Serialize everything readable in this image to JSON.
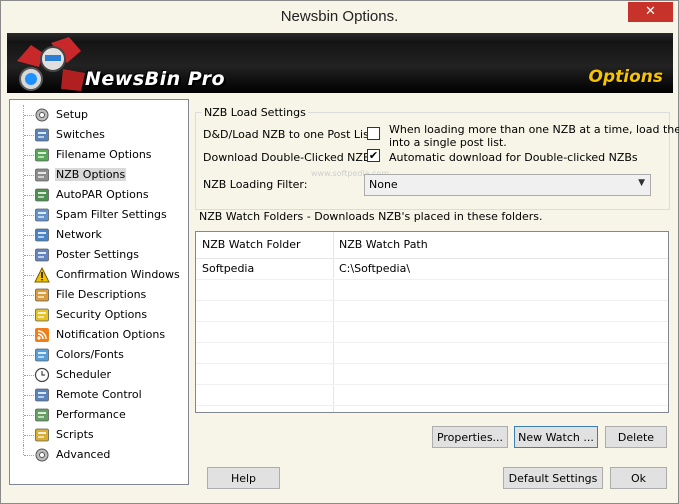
{
  "window": {
    "title": "Newsbin Options.",
    "close_label": "✕"
  },
  "banner": {
    "brand": "NewsBin Pro",
    "section": "Options"
  },
  "sidebar": {
    "items": [
      {
        "label": "Setup",
        "icon": "gear-icon"
      },
      {
        "label": "Switches",
        "icon": "switches-icon"
      },
      {
        "label": "Filename Options",
        "icon": "filename-icon"
      },
      {
        "label": "NZB Options",
        "icon": "nzb-icon",
        "selected": true
      },
      {
        "label": "AutoPAR Options",
        "icon": "autopar-icon"
      },
      {
        "label": "Spam Filter Settings",
        "icon": "spam-filter-icon"
      },
      {
        "label": "Network",
        "icon": "network-icon"
      },
      {
        "label": "Poster Settings",
        "icon": "poster-icon"
      },
      {
        "label": "Confirmation Windows",
        "icon": "warning-icon"
      },
      {
        "label": "File Descriptions",
        "icon": "file-descriptions-icon"
      },
      {
        "label": "Security Options",
        "icon": "security-icon"
      },
      {
        "label": "Notification Options",
        "icon": "rss-icon"
      },
      {
        "label": "Colors/Fonts",
        "icon": "colors-icon"
      },
      {
        "label": "Scheduler",
        "icon": "clock-icon"
      },
      {
        "label": "Remote Control",
        "icon": "remote-icon"
      },
      {
        "label": "Performance",
        "icon": "performance-icon"
      },
      {
        "label": "Scripts",
        "icon": "scripts-icon"
      },
      {
        "label": "Advanced",
        "icon": "advanced-gear-icon"
      }
    ]
  },
  "nzb_load": {
    "group_title": "NZB Load Settings",
    "row1_label": "D&D/Load NZB to one Post List:",
    "row1_checkbox_line1": "When loading more than one NZB at a time, load them",
    "row1_checkbox_line2": "into a single post list.",
    "row1_checked": false,
    "row2_label": "Download Double-Clicked NZB:",
    "row2_checkbox": "Automatic download for Double-clicked NZBs",
    "row2_checked": true,
    "filter_label": "NZB Loading Filter:",
    "filter_value": "None",
    "watermark": "www.softpedia.com"
  },
  "watch": {
    "caption": "NZB Watch Folders - Downloads NZB's placed in these folders.",
    "columns": [
      "NZB Watch Folder",
      "NZB Watch Path"
    ],
    "rows": [
      [
        "Softpedia",
        "C:\\Softpedia\\"
      ]
    ]
  },
  "buttons": {
    "properties": "Properties...",
    "new_watch": "New Watch ...",
    "delete": "Delete",
    "help": "Help",
    "default_settings": "Default Settings",
    "ok": "Ok"
  }
}
